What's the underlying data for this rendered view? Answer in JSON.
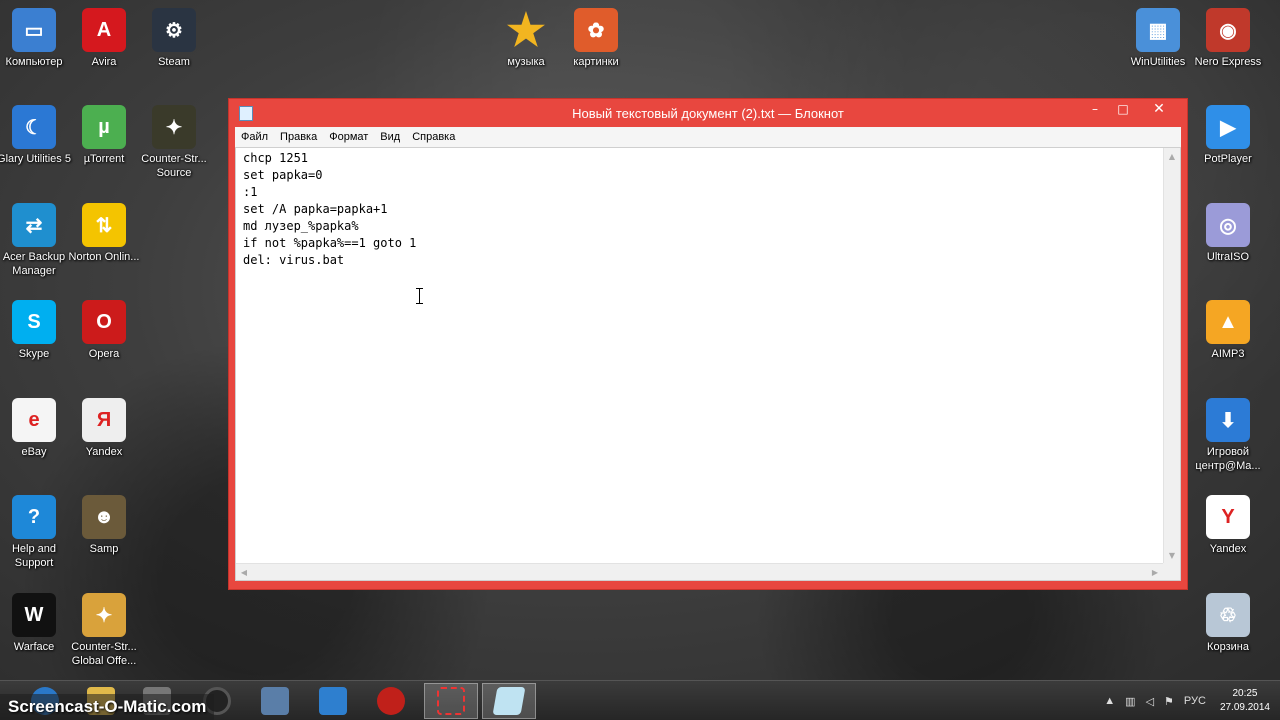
{
  "desktop": {
    "icons": [
      {
        "label": "Компьютер",
        "icon": "computer-icon",
        "color": "#3b7fd1"
      },
      {
        "label": "Avira",
        "icon": "avira-icon",
        "color": "#d5181e"
      },
      {
        "label": "Steam",
        "icon": "steam-icon",
        "color": "#2a3442"
      },
      {
        "label": "музыка",
        "icon": "star-icon",
        "color": "#f2b520"
      },
      {
        "label": "картинки",
        "icon": "butterfly-icon",
        "color": "#e05c2b"
      },
      {
        "label": "WinUtilities",
        "icon": "winutilities-icon",
        "color": "#4a90d9"
      },
      {
        "label": "Nero Express",
        "icon": "nero-icon",
        "color": "#c0392b"
      },
      {
        "label": "Glary Utilities 5",
        "icon": "glary-icon",
        "color": "#2b78d4"
      },
      {
        "label": "µTorrent",
        "icon": "utorrent-icon",
        "color": "#4caf50"
      },
      {
        "label": "Counter-Str... Source",
        "icon": "counter-strike-icon",
        "color": "#3a3a2a"
      },
      {
        "label": "PotPlayer",
        "icon": "potplayer-icon",
        "color": "#2f8fe8"
      },
      {
        "label": "Acer Backup Manager",
        "icon": "acer-backup-icon",
        "color": "#1f8fcf"
      },
      {
        "label": "Norton Onlin...",
        "icon": "norton-icon",
        "color": "#f4c400"
      },
      {
        "label": "UltraISO",
        "icon": "ultraiso-icon",
        "color": "#9b9bd8"
      },
      {
        "label": "Skype",
        "icon": "skype-icon",
        "color": "#00aff0"
      },
      {
        "label": "Opera",
        "icon": "opera-icon",
        "color": "#cc1b1b"
      },
      {
        "label": "AIMP3",
        "icon": "aimp-icon",
        "color": "#f5a623"
      },
      {
        "label": "eBay",
        "icon": "ebay-icon",
        "color": "#f5f5f5"
      },
      {
        "label": "Yandex",
        "icon": "yandex-icon",
        "color": "#eeeeee"
      },
      {
        "label": "Игровой центр@Ma...",
        "icon": "game-center-icon",
        "color": "#2c7bd6"
      },
      {
        "label": "Help and Support",
        "icon": "help-icon",
        "color": "#1e88d8"
      },
      {
        "label": "Samp",
        "icon": "samp-icon",
        "color": "#6b5a3a"
      },
      {
        "label": "Yandex",
        "icon": "yandex-browser-icon",
        "color": "#ffffff"
      },
      {
        "label": "Warface",
        "icon": "warface-icon",
        "color": "#111111"
      },
      {
        "label": "Counter-Str... Global Offe...",
        "icon": "csgo-icon",
        "color": "#d9a23b"
      },
      {
        "label": "Корзина",
        "icon": "recycle-bin-icon",
        "color": "#b8c7d6"
      }
    ]
  },
  "notepad": {
    "title": "Новый текстовый документ (2).txt — Блокнот",
    "menu": [
      "Файл",
      "Правка",
      "Формат",
      "Вид",
      "Справка"
    ],
    "content": "chcp 1251\nset papka=0\n:1\nset /A papka=papka+1\nmd лузер_%papka%\nif not %papka%==1 goto 1\ndel: virus.bat",
    "buttons": {
      "minimize": "–",
      "maximize": "□",
      "close": "✕"
    },
    "accent_color": "#e8473f"
  },
  "taskbar": {
    "watermark": "Screencast-O-Matic.com",
    "tray": {
      "language": "РУС",
      "time": "20:25",
      "date": "27.09.2014"
    }
  }
}
